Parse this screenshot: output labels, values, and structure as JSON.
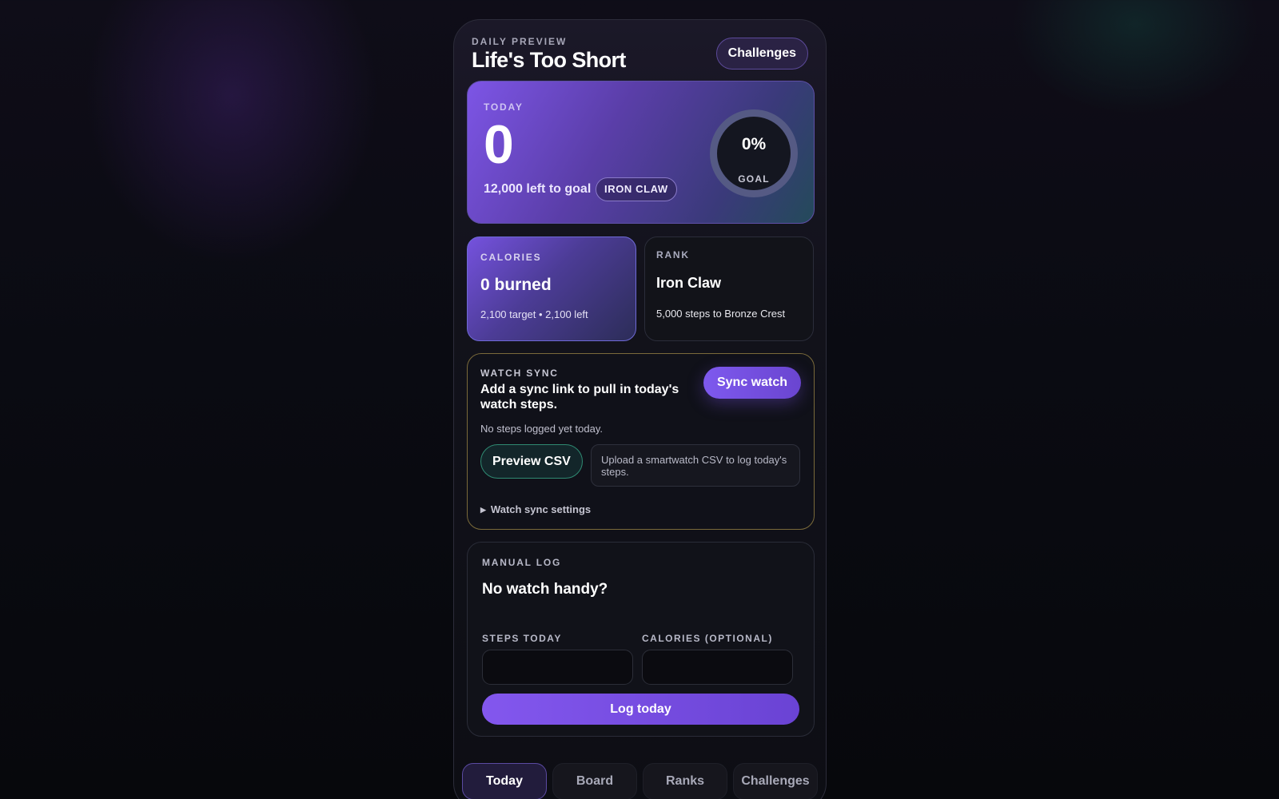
{
  "header": {
    "eyebrow": "DAILY PREVIEW",
    "title": "Life's Too Short",
    "challenges_button": "Challenges"
  },
  "today": {
    "label": "TODAY",
    "steps": "0",
    "left_to_goal": "12,000 left to goal",
    "rank_badge": "IRON CLAW",
    "goal_percent": "0%",
    "goal_label": "GOAL",
    "goal_progress": 0
  },
  "calories": {
    "label": "CALORIES",
    "value": "0 burned",
    "sub": "2,100 target • 2,100 left"
  },
  "rank": {
    "label": "RANK",
    "value": "Iron Claw",
    "sub": "5,000 steps to Bronze Crest"
  },
  "watch_sync": {
    "label": "WATCH SYNC",
    "headline": "Add a sync link to pull in today's watch steps.",
    "sync_button": "Sync watch",
    "status": "No steps logged yet today.",
    "csv_button": "Preview CSV",
    "csv_hint": "Upload a smartwatch CSV to log today's steps.",
    "settings_toggle": "Watch sync settings"
  },
  "manual_log": {
    "label": "MANUAL LOG",
    "headline": "No watch handy?",
    "steps_label": "STEPS TODAY",
    "steps_value": "",
    "calories_label": "CALORIES (OPTIONAL)",
    "calories_value": "",
    "log_button": "Log today"
  },
  "nav": {
    "tabs": [
      {
        "label": "Today",
        "active": true
      },
      {
        "label": "Board",
        "active": false
      },
      {
        "label": "Ranks",
        "active": false
      },
      {
        "label": "Challenges",
        "active": false
      }
    ]
  },
  "colors": {
    "accent": "#7e59ee",
    "accent_teal": "#2f8a72",
    "sync_border": "#7a6a3a"
  }
}
